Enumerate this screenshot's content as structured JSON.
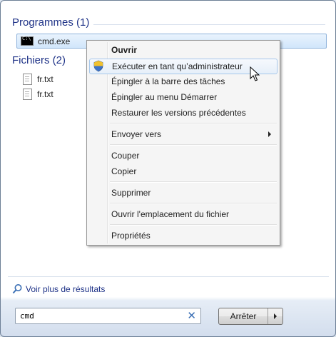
{
  "results": {
    "programs_title": "Programmes (1)",
    "programs": [
      {
        "label": "cmd.exe",
        "icon": "cmd-icon"
      }
    ],
    "files_title": "Fichiers (2)",
    "files": [
      {
        "label": "fr.txt",
        "icon": "text-file-icon"
      },
      {
        "label": "fr.txt",
        "icon": "text-file-icon"
      }
    ]
  },
  "context_menu": {
    "items": [
      {
        "label": "Ouvrir"
      },
      {
        "label": "Exécuter en tant qu’administrateur",
        "icon": "uac-shield-icon"
      },
      {
        "label": "Épingler à la barre des tâches"
      },
      {
        "label": "Épingler au menu Démarrer"
      },
      {
        "label": "Restaurer les versions précédentes"
      },
      {
        "label": "Envoyer vers"
      },
      {
        "label": "Couper"
      },
      {
        "label": "Copier"
      },
      {
        "label": "Supprimer"
      },
      {
        "label": "Ouvrir l'emplacement du fichier"
      },
      {
        "label": "Propriétés"
      }
    ]
  },
  "footer": {
    "see_more": "Voir plus de résultats",
    "search_value": "cmd",
    "stop_label": "Arrêter"
  },
  "colors": {
    "accent_text": "#1e3287",
    "selection_border": "#8fb3dc"
  }
}
